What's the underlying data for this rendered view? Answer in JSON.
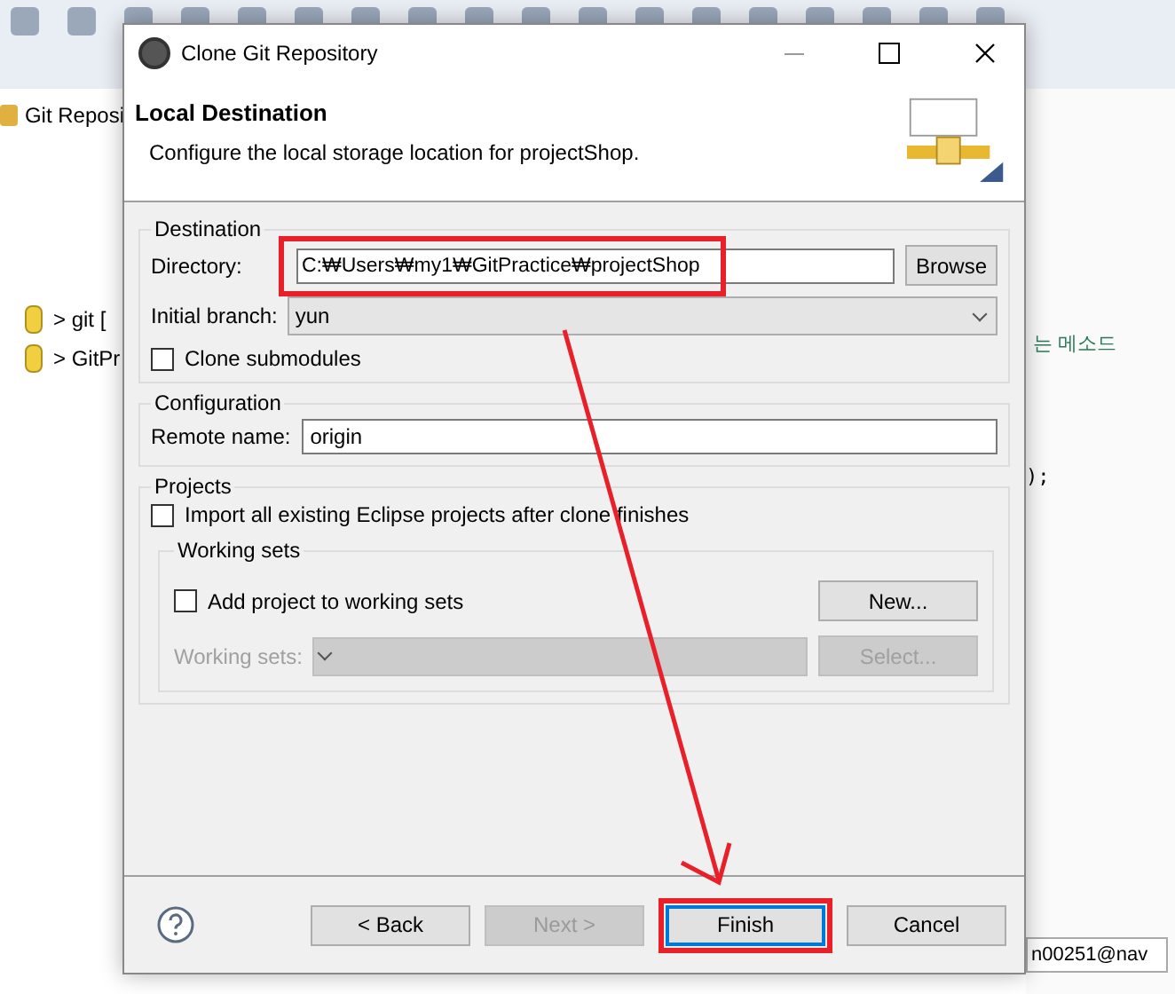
{
  "ide": {
    "view_title": "Git Reposi",
    "tree": [
      {
        "label": "> git ["
      },
      {
        "label": "> GitPr"
      }
    ],
    "code_fragments": [
      "는 메소드",
      ");"
    ],
    "email_fragment": "n00251@nav"
  },
  "dialog": {
    "title": "Clone Git Repository",
    "heading": "Local Destination",
    "description": "Configure the local storage location for projectShop.",
    "destination": {
      "legend": "Destination",
      "directory_label": "Directory:",
      "directory": "C:₩Users₩my1₩GitPractice₩projectShop",
      "browse": "Browse",
      "branch_label": "Initial branch:",
      "branch": "yun",
      "clone_submodules": {
        "label": "Clone submodules",
        "checked": false
      }
    },
    "configuration": {
      "legend": "Configuration",
      "remote_label": "Remote name:",
      "remote": "origin"
    },
    "projects": {
      "legend": "Projects",
      "import": {
        "label": "Import all existing Eclipse projects after clone finishes",
        "checked": false
      },
      "working_sets": {
        "legend": "Working sets",
        "add": {
          "label": "Add project to working sets",
          "checked": false
        },
        "sets_label": "Working sets:",
        "disabled": true,
        "new": "New...",
        "select": "Select..."
      }
    },
    "buttons": [
      {
        "label": "< Back",
        "disabled": false,
        "default": false
      },
      {
        "label": "Next >",
        "disabled": true,
        "default": false
      },
      {
        "label": "Finish",
        "disabled": false,
        "default": true
      },
      {
        "label": "Cancel",
        "disabled": false,
        "default": false
      }
    ]
  }
}
